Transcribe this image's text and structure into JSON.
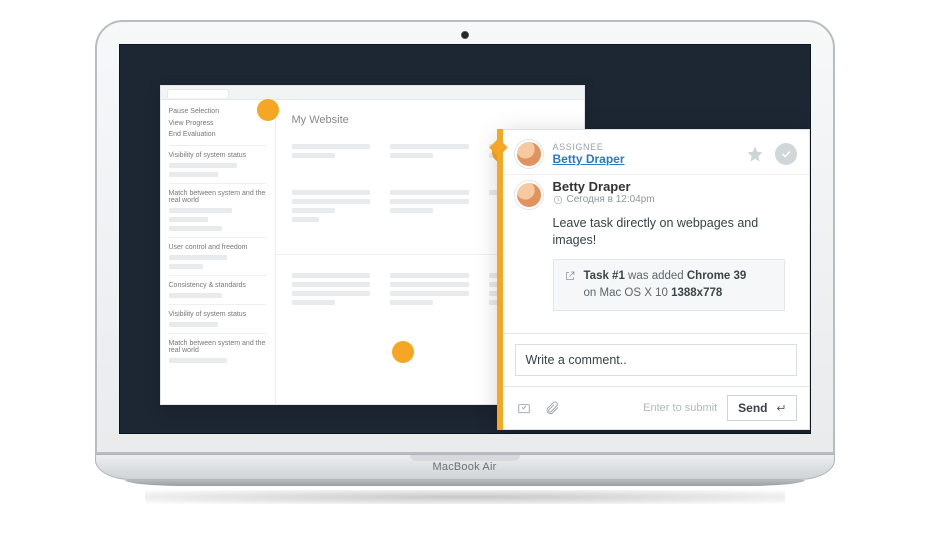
{
  "laptop": {
    "brand": "MacBook Air"
  },
  "mock": {
    "title": "My Website",
    "sidebar": {
      "actions": [
        "Pause Selection",
        "View Progress",
        "End Evaluation"
      ],
      "heuristics": [
        "Visibility of system status",
        "Match between system and the real world",
        "User control and freedom",
        "Consistency & standards",
        "Visibility of system status",
        "Match between system and the real world"
      ]
    }
  },
  "panel": {
    "assignee_label": "ASSIGNEE",
    "assignee_name": "Betty Draper",
    "post": {
      "author": "Betty Draper",
      "time": "Сегодня в 12:04pm",
      "text": "Leave task directly on webpages and images!"
    },
    "meta": {
      "task_label": "Task #1",
      "was_added": " was added ",
      "browser": "Chrome 39",
      "on": " on ",
      "os": "Mac OS X 10",
      "resolution": "1388x778"
    },
    "comment_placeholder": "Write a comment..",
    "submit_hint": "Enter to submit",
    "send_label": "Send"
  }
}
